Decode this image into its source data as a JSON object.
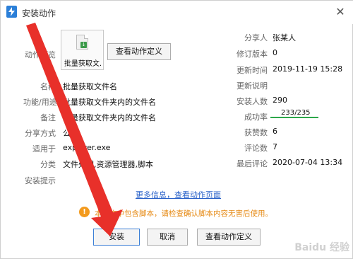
{
  "window": {
    "title": "安装动作",
    "close_glyph": "✕"
  },
  "thumbnail": {
    "caption": "批量获取文."
  },
  "buttons": {
    "view_definition_top": "查看动作定义",
    "install": "安装",
    "cancel": "取消",
    "view_definition_bottom": "查看动作定义"
  },
  "left_fields": [
    {
      "label": "动作预览",
      "value": ""
    },
    {
      "label": "名称",
      "value": "批量获取文件名"
    },
    {
      "label": "功能/用途",
      "value": "批量获取文件夹内的文件名"
    },
    {
      "label": "备注",
      "value": "批量获取文件夹内的文件名"
    },
    {
      "label": "分享方式",
      "value": "公开"
    },
    {
      "label": "适用于",
      "value": "explorer.exe"
    },
    {
      "label": "分类",
      "value": "文件处理,资源管理器,脚本"
    },
    {
      "label": "安装提示",
      "value": ""
    }
  ],
  "right_fields": [
    {
      "label": "分享人",
      "value": "张某人"
    },
    {
      "label": "修订版本",
      "value": "0"
    },
    {
      "label": "更新时间",
      "value": "2019-11-19 15:28"
    },
    {
      "label": "更新说明",
      "value": ""
    },
    {
      "label": "安装人数",
      "value": "290"
    },
    {
      "label": "成功率",
      "value": "233/235"
    },
    {
      "label": "获赞数",
      "value": "6"
    },
    {
      "label": "评论数",
      "value": "7"
    },
    {
      "label": "最后评论",
      "value": "2020-07-04 13:34"
    }
  ],
  "success_rate_fraction": 0.991,
  "more_info_link": "更多信息，查看动作页面",
  "warning": {
    "icon": "!",
    "text": "本动作中包含脚本，请检查确认脚本内容无害后使用。"
  },
  "watermark": "Baidu 经验",
  "colors": {
    "accent_blue": "#2b7fd8",
    "link": "#2a62c9",
    "warning": "#f39a1d",
    "success": "#2ca84a",
    "arrow": "#e8302a"
  }
}
